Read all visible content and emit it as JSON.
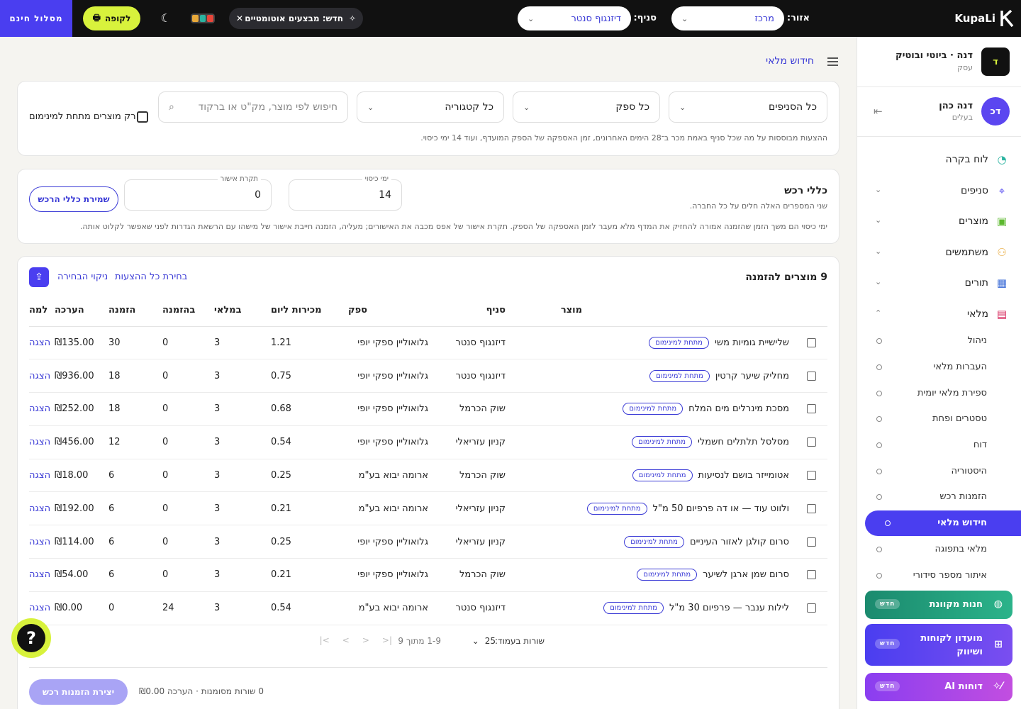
{
  "topbar": {
    "logo": "KupaLi",
    "area_label": "אזור:",
    "area_value": "מרכז",
    "branch_label": "סניף:",
    "branch_value": "דיזנגוף סנטר",
    "new_chip": "חדש: מבצעים אוטומטיים",
    "pos_button": "לקופה",
    "free_plan": "מסלול חינם",
    "colors": [
      "#e8463a",
      "#2bb3a0",
      "#e8a93a"
    ]
  },
  "sidebar": {
    "business_initial": "ד",
    "business_name": "דנה · ביוטי ובוטיק",
    "business_type": "עסק",
    "user_initials": "דכ",
    "user_name": "דנה כהן",
    "user_role": "בעלים",
    "nav": [
      {
        "label": "לוח בקרה",
        "icon": "dashboard-icon",
        "expandable": false
      },
      {
        "label": "סניפים",
        "icon": "map-pin-icon",
        "expandable": true
      },
      {
        "label": "מוצרים",
        "icon": "shopping-bag-icon",
        "expandable": true
      },
      {
        "label": "משתמשים",
        "icon": "users-icon",
        "expandable": true
      },
      {
        "label": "תורים",
        "icon": "calendar-icon",
        "expandable": true
      },
      {
        "label": "מלאי",
        "icon": "inventory-icon",
        "expandable": true,
        "open": true
      }
    ],
    "inventory_sub": [
      "ניהול",
      "העברות מלאי",
      "ספירת מלאי יומית",
      "טסטרים ופחת",
      "דוח",
      "היסטוריה",
      "הזמנות רכש",
      "חידוש מלאי",
      "מלאי בתפוגה",
      "איתור מספר סידורי"
    ],
    "active_sub": "חידוש מלאי",
    "promos": [
      {
        "label": "חנות מקוונת",
        "badge": "חדש",
        "icon": "globe-icon"
      },
      {
        "label": "מועדון לקוחות ושיווק",
        "badge": "חדש",
        "icon": "gift-icon"
      },
      {
        "label": "דוחות AI",
        "badge": "חדש",
        "icon": "magic-wand-icon"
      }
    ]
  },
  "page": {
    "breadcrumb": "חידוש מלאי"
  },
  "filters": {
    "branches": "כל הסניפים",
    "supplier": "כל ספק",
    "category": "כל קטגוריה",
    "search_placeholder": "חיפוש לפי מוצר, מק\"ט או ברקוד",
    "below_min_label": "רק מוצרים מתחת למינימום",
    "note": "ההצעות מבוססות על מה שכל סניף באמת מכר ב־28 הימים האחרונים, זמן האספקה של הספק המועדף, ועוד 14 ימי כיסוי."
  },
  "rules": {
    "title": "כללי רכש",
    "subtitle": "שני המספרים האלה חלים על כל החברה.",
    "coverage_label": "ימי כיסוי",
    "coverage_value": "14",
    "approval_label": "תקרת אישור",
    "approval_value": "0",
    "save_button": "שמירת כללי הרכש",
    "note": "ימי כיסוי הם משך הזמן שהזמנה אמורה להחזיק את המדף מלא מעבר לזמן האספקה של הספק. תקרת אישור של אפס מכבה את האישורים; מעליה, הזמנה חייבת אישור של מישהו עם הרשאת הגדרות לפני שאפשר לקלוט אותה."
  },
  "table": {
    "title": "9 מוצרים להזמנה",
    "select_all": "בחירת כל ההצעות",
    "clear_selection": "ניקוי הבחירה",
    "below_min_tag": "מתחת למינימום",
    "columns": [
      "מוצר",
      "סניף",
      "ספק",
      "מכירות ליום",
      "במלאי",
      "בהזמנה",
      "הזמנה",
      "הערכה",
      "למה"
    ],
    "rows": [
      {
        "product": "שלישיית גומיות משי",
        "branch": "דיזנגוף סנטר",
        "supplier": "גלואוליין ספקי יופי",
        "daily": "1.21",
        "stock": "3",
        "on_order": "0",
        "order": "30",
        "estimate": "₪135.00",
        "why": "הצגה"
      },
      {
        "product": "מחליק שיער קרטין",
        "branch": "דיזנגוף סנטר",
        "supplier": "גלואוליין ספקי יופי",
        "daily": "0.75",
        "stock": "3",
        "on_order": "0",
        "order": "18",
        "estimate": "₪936.00",
        "why": "הצגה"
      },
      {
        "product": "מסכת מינרלים מים המלח",
        "branch": "שוק הכרמל",
        "supplier": "גלואוליין ספקי יופי",
        "daily": "0.68",
        "stock": "3",
        "on_order": "0",
        "order": "18",
        "estimate": "₪252.00",
        "why": "הצגה"
      },
      {
        "product": "מסלסל תלתלים חשמלי",
        "branch": "קניון עזריאלי",
        "supplier": "גלואוליין ספקי יופי",
        "daily": "0.54",
        "stock": "3",
        "on_order": "0",
        "order": "12",
        "estimate": "₪456.00",
        "why": "הצגה"
      },
      {
        "product": "אטומייזר בושם לנסיעות",
        "branch": "שוק הכרמל",
        "supplier": "ארומה יבוא בע\"מ",
        "daily": "0.25",
        "stock": "3",
        "on_order": "0",
        "order": "6",
        "estimate": "₪18.00",
        "why": "הצגה"
      },
      {
        "product": "ולווט עוד — או דה פרפיום 50 מ\"ל",
        "branch": "קניון עזריאלי",
        "supplier": "ארומה יבוא בע\"מ",
        "daily": "0.21",
        "stock": "3",
        "on_order": "0",
        "order": "6",
        "estimate": "₪192.00",
        "why": "הצגה"
      },
      {
        "product": "סרום קולגן לאזור העיניים",
        "branch": "קניון עזריאלי",
        "supplier": "גלואוליין ספקי יופי",
        "daily": "0.25",
        "stock": "3",
        "on_order": "0",
        "order": "6",
        "estimate": "₪114.00",
        "why": "הצגה"
      },
      {
        "product": "סרום שמן ארגן לשיער",
        "branch": "שוק הכרמל",
        "supplier": "גלואוליין ספקי יופי",
        "daily": "0.21",
        "stock": "3",
        "on_order": "0",
        "order": "6",
        "estimate": "₪54.00",
        "why": "הצגה"
      },
      {
        "product": "לילות ענבר — פרפיום 30 מ\"ל",
        "branch": "דיזנגוף סנטר",
        "supplier": "ארומה יבוא בע\"מ",
        "daily": "0.54",
        "stock": "3",
        "on_order": "24",
        "order": "0",
        "estimate": "₪0.00",
        "why": "הצגה"
      }
    ],
    "rows_per_page_label": "שורות בעמוד:",
    "rows_per_page": "25",
    "range": "1-9 מתוך 9"
  },
  "footer": {
    "summary": "0 שורות מסומנות · הערכה ₪0.00",
    "create_button": "יצירת הזמנות רכש"
  }
}
